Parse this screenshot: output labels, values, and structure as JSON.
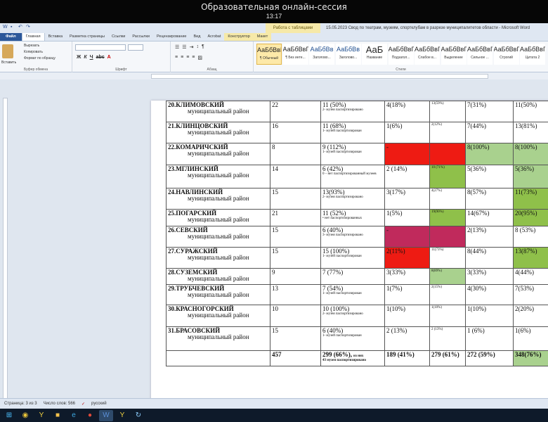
{
  "session": {
    "title": "Образовательная онлайн-сессия",
    "clock": "13:17"
  },
  "word": {
    "contextual_tab_group": "Работа с таблицами",
    "doc_title": "15.05.2023 Свод по театрам, музеям, спортклубам в разрезе муниципалитетов области  -  Microsoft Word",
    "tabs": [
      "Файл",
      "Главная",
      "Вставка",
      "Разметка страницы",
      "Ссылки",
      "Рассылки",
      "Рецензирование",
      "Вид",
      "Acrobat",
      "Конструктор",
      "Макет"
    ],
    "clipboard": {
      "paste": "Вставить",
      "cut": "Вырезать",
      "copy": "Копировать",
      "format": "Формат по образцу",
      "group": "Буфер обмена"
    },
    "font_group": "Шрифт",
    "para_group": "Абзац",
    "styles_group": "Стили",
    "styles": [
      {
        "sample": "АаБбВвГг",
        "name": "¶ Обычный"
      },
      {
        "sample": "АаБбВвГг",
        "name": "¶ Без инте..."
      },
      {
        "sample": "АаБбВв",
        "name": "Заголово..."
      },
      {
        "sample": "АаБбВв",
        "name": "Заголово..."
      },
      {
        "sample": "АаБ",
        "name": "Название"
      },
      {
        "sample": "АаБбВвГ",
        "name": "Подзагол..."
      },
      {
        "sample": "АаБбВвГг",
        "name": "Слабое в..."
      },
      {
        "sample": "АаБбВвГг",
        "name": "Выделение"
      },
      {
        "sample": "АаБбВвГг",
        "name": "Сильное ..."
      },
      {
        "sample": "АаБбВвГг",
        "name": "Строгий"
      },
      {
        "sample": "АаБбВвГ",
        "name": "Цитата 2"
      }
    ],
    "status": {
      "page": "Страница: 3 из 3",
      "words": "Число слов: 566",
      "lang": "русский"
    }
  },
  "table": {
    "rows": [
      {
        "num_name": "20.КЛИМОВСКИЙ",
        "sub": "муниципальный район",
        "c1": "22",
        "c2": "11 (50%)",
        "c2note": "2- музея паспортизировано",
        "c3": "4(18%)",
        "c4": "13(59%)",
        "c5": "7(31%)",
        "c6": "11(50%)"
      },
      {
        "num_name": "21.КЛИНЦОВСКИЙ",
        "sub": "муниципальный район",
        "c1": "16",
        "c2": "11 (68%)",
        "c2note": "1- музей паспортизирован",
        "c3": "1(6%)",
        "c4": "2(12%)",
        "c5": "7(44%)",
        "c6": "13(81%)"
      },
      {
        "num_name": "22.КОМАРИЧСКИЙ",
        "sub": "муниципальный район",
        "c1": "8",
        "c2": "9 (112%)",
        "c2note": "1- музей паспортизирован",
        "c3": "-",
        "c4": "",
        "c5": "8(100%)",
        "c6": "8(100%)"
      },
      {
        "num_name": "23.МГЛИНСКИЙ",
        "sub": "муниципальный район",
        "c1": "14",
        "c2": "6 (42%)",
        "c2note": "0 – нет паспортизированный музеев",
        "c3": "2 (14%)",
        "c4": "10 (71%)",
        "c5": "5(36%)",
        "c6": "5(36%)"
      },
      {
        "num_name": "24.НАВЛИНСКИЙ",
        "sub": "муниципальный район",
        "c1": "15",
        "c2": "13(93%)",
        "c2note": "2- музея паспортизировано",
        "c3": "3(17%)",
        "c4": "4(27%)",
        "c5": "8(57%)",
        "c6": "11(73%)"
      },
      {
        "num_name": "25.ПОГАРСКИЙ",
        "sub": "муниципальный район",
        "c1": "21",
        "c2": "11 (52%)",
        "c2note": "• нет паспортизированных",
        "c3": "1(5%)",
        "c4": "19(90%)",
        "c5": "14(67%)",
        "c6": "20(95%)"
      },
      {
        "num_name": "26.СЕВСКИЙ",
        "sub": "муниципальный район",
        "c1": "15",
        "c2": "6 (40%)",
        "c2note": "3- музея паспортизировано",
        "c3": "-",
        "c4": "",
        "c5": "2(13%)",
        "c6": "8 (53%)"
      },
      {
        "num_name": "27.СУРАЖСКИЙ",
        "sub": "муниципальный район",
        "c1": "15",
        "c2": "15 (100%)",
        "c2note": "1- музей паспортизирован",
        "c3": "2(11%)",
        "c4": "11(73%)",
        "c5": "8(44%)",
        "c6": "13(87%)"
      },
      {
        "num_name": "28.СУЗЕМСКИЙ",
        "sub": "муниципальный район",
        "c1": "9",
        "c2": "7 (77%)",
        "c2note": "",
        "c3": "3(33%)",
        "c4": "8(89%)",
        "c5": "3(33%)",
        "c6": "4(44%)"
      },
      {
        "num_name": "29.ТРУБЧЕВСКИЙ",
        "sub": "муниципальный район",
        "c1": "13",
        "c2": "7 (54%)",
        "c2note": "1- музей паспортизирован",
        "c3": "1(7%)",
        "c4": "2(15%)",
        "c5": "4(30%)",
        "c6": "7(53%)"
      },
      {
        "num_name": "30.КРАСНОГОРСКИЙ",
        "sub": "муниципальный район",
        "c1": "10",
        "c2": "10 (100%)",
        "c2note": "2- музея паспортизировано",
        "c3": "1(10%)",
        "c4": "1(10%)",
        "c5": "1(10%)",
        "c6": "2(20%)"
      },
      {
        "num_name": "31.БРАСОВСКИЙ",
        "sub": "муниципальный район",
        "c1": "15",
        "c2": "6 (40%)",
        "c2note": "1- музей паспортизирован",
        "c3": "2 (13%)",
        "c4": "2 (13%)",
        "c5": "1 (6%)",
        "c6": "1(6%)"
      }
    ],
    "total": {
      "c1": "457",
      "c2": "299 (66%),",
      "c2a": "из них",
      "c2note": "43 музея паспортизировано",
      "c3": "189 (41%)",
      "c4": "279 (61%)",
      "c5": "272 (59%)",
      "c6": "348(76%)"
    }
  }
}
